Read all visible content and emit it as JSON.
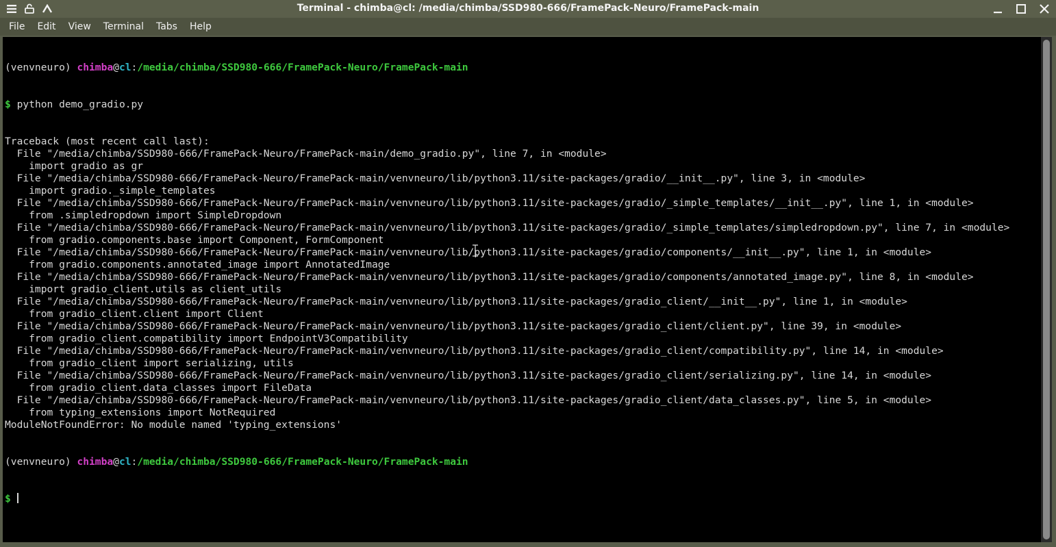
{
  "window": {
    "title": "Terminal - chimba@cl: /media/chimba/SSD980-666/FramePack-Neuro/FramePack-main",
    "controls": [
      "menu-icon",
      "pin-icon",
      "up-arrow-icon"
    ],
    "window_buttons": [
      "minimize-icon",
      "maximize-icon",
      "close-icon"
    ]
  },
  "menu": {
    "items": [
      "File",
      "Edit",
      "View",
      "Terminal",
      "Tabs",
      "Help"
    ]
  },
  "colors": {
    "user": "#d340c8",
    "host": "#2fb6c8",
    "path": "#3ec93e",
    "text": "#d8d8d8",
    "background": "#000000"
  },
  "terminal": {
    "prompt1": {
      "env": "(venvneuro) ",
      "user": "chimba",
      "at": "@",
      "host": "cl",
      "colon": ":",
      "path": "/media/chimba/SSD980-666/FramePack-Neuro/FramePack-main"
    },
    "command_line": {
      "dollar": "$",
      "command": " python demo_gradio.py"
    },
    "output": [
      "Traceback (most recent call last):",
      "  File \"/media/chimba/SSD980-666/FramePack-Neuro/FramePack-main/demo_gradio.py\", line 7, in <module>",
      "    import gradio as gr",
      "  File \"/media/chimba/SSD980-666/FramePack-Neuro/FramePack-main/venvneuro/lib/python3.11/site-packages/gradio/__init__.py\", line 3, in <module>",
      "    import gradio._simple_templates",
      "  File \"/media/chimba/SSD980-666/FramePack-Neuro/FramePack-main/venvneuro/lib/python3.11/site-packages/gradio/_simple_templates/__init__.py\", line 1, in <module>",
      "    from .simpledropdown import SimpleDropdown",
      "  File \"/media/chimba/SSD980-666/FramePack-Neuro/FramePack-main/venvneuro/lib/python3.11/site-packages/gradio/_simple_templates/simpledropdown.py\", line 7, in <module>",
      "    from gradio.components.base import Component, FormComponent",
      "  File \"/media/chimba/SSD980-666/FramePack-Neuro/FramePack-main/venvneuro/lib/python3.11/site-packages/gradio/components/__init__.py\", line 1, in <module>",
      "    from gradio.components.annotated_image import AnnotatedImage",
      "  File \"/media/chimba/SSD980-666/FramePack-Neuro/FramePack-main/venvneuro/lib/python3.11/site-packages/gradio/components/annotated_image.py\", line 8, in <module>",
      "    import gradio_client.utils as client_utils",
      "  File \"/media/chimba/SSD980-666/FramePack-Neuro/FramePack-main/venvneuro/lib/python3.11/site-packages/gradio_client/__init__.py\", line 1, in <module>",
      "    from gradio_client.client import Client",
      "  File \"/media/chimba/SSD980-666/FramePack-Neuro/FramePack-main/venvneuro/lib/python3.11/site-packages/gradio_client/client.py\", line 39, in <module>",
      "    from gradio_client.compatibility import EndpointV3Compatibility",
      "  File \"/media/chimba/SSD980-666/FramePack-Neuro/FramePack-main/venvneuro/lib/python3.11/site-packages/gradio_client/compatibility.py\", line 14, in <module>",
      "    from gradio_client import serializing, utils",
      "  File \"/media/chimba/SSD980-666/FramePack-Neuro/FramePack-main/venvneuro/lib/python3.11/site-packages/gradio_client/serializing.py\", line 14, in <module>",
      "    from gradio_client.data_classes import FileData",
      "  File \"/media/chimba/SSD980-666/FramePack-Neuro/FramePack-main/venvneuro/lib/python3.11/site-packages/gradio_client/data_classes.py\", line 5, in <module>",
      "    from typing_extensions import NotRequired",
      "ModuleNotFoundError: No module named 'typing_extensions'"
    ],
    "prompt2": {
      "env": "(venvneuro) ",
      "user": "chimba",
      "at": "@",
      "host": "cl",
      "colon": ":",
      "path": "/media/chimba/SSD980-666/FramePack-Neuro/FramePack-main"
    },
    "final_line": {
      "dollar": "$",
      "space": " "
    }
  }
}
